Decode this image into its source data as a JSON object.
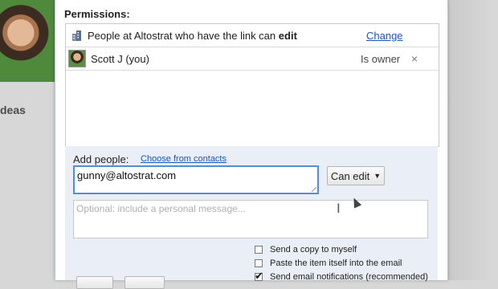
{
  "background": {
    "side_text": "deas"
  },
  "permissions": {
    "title": "Permissions:",
    "link_row": {
      "text_prefix": "People at Altostrat who have the link can",
      "text_access": "edit",
      "change_label": "Change"
    },
    "users": [
      {
        "name": "Scott J (you)",
        "role": "Is owner",
        "remove_icon": "×"
      }
    ]
  },
  "add_people": {
    "label": "Add people:",
    "choose_link": "Choose from contacts",
    "email_value": "gunny@altostrat.com",
    "permission_button": "Can edit",
    "message_placeholder": "Optional: include a personal message...",
    "options": [
      {
        "label": "Send a copy to myself",
        "checked": false
      },
      {
        "label": "Paste the item itself into the email",
        "checked": false
      },
      {
        "label": "Send email notifications (recommended)",
        "checked": true
      }
    ]
  },
  "colors": {
    "link": "#1a55c4",
    "input_focus": "#4d90d6",
    "add_area_bg": "#e9eef7"
  }
}
